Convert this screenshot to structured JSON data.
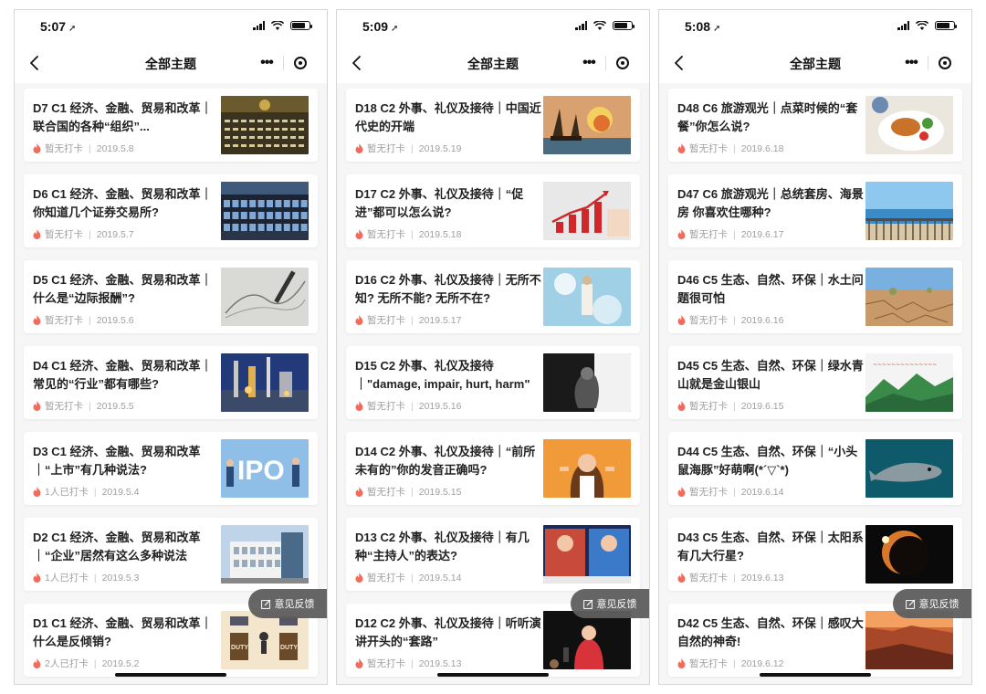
{
  "phones": [
    {
      "time": "5:07",
      "title": "全部主题",
      "feedback": "意见反馈",
      "items": [
        {
          "title": "D7 C1 经济、金融、贸易和改革｜联合国的各种“组织”...",
          "checkin": "暂无打卡",
          "date": "2019.5.8"
        },
        {
          "title": "D6 C1 经济、金融、贸易和改革｜你知道几个证券交易所?",
          "checkin": "暂无打卡",
          "date": "2019.5.7"
        },
        {
          "title": "D5 C1 经济、金融、贸易和改革｜什么是“边际报酬”?",
          "checkin": "暂无打卡",
          "date": "2019.5.6"
        },
        {
          "title": "D4 C1 经济、金融、贸易和改革｜常见的“行业”都有哪些?",
          "checkin": "暂无打卡",
          "date": "2019.5.5"
        },
        {
          "title": "D3 C1 经济、金融、贸易和改革｜“上市”有几种说法?",
          "checkin": "1人已打卡",
          "date": "2019.5.4"
        },
        {
          "title": "D2 C1 经济、金融、贸易和改革｜“企业”居然有这么多种说法",
          "checkin": "1人已打卡",
          "date": "2019.5.3"
        },
        {
          "title": "D1 C1 经济、金融、贸易和改革｜什么是反倾销?",
          "checkin": "2人已打卡",
          "date": "2019.5.2"
        }
      ]
    },
    {
      "time": "5:09",
      "title": "全部主题",
      "feedback": "意见反馈",
      "items": [
        {
          "title": "D18 C2 外事、礼仪及接待｜中国近代史的开端",
          "checkin": "暂无打卡",
          "date": "2019.5.19"
        },
        {
          "title": "D17 C2 外事、礼仪及接待｜“促进”都可以怎么说?",
          "checkin": "暂无打卡",
          "date": "2019.5.18"
        },
        {
          "title": "D16 C2 外事、礼仪及接待｜无所不知? 无所不能? 无所不在?",
          "checkin": "暂无打卡",
          "date": "2019.5.17"
        },
        {
          "title": "D15 C2 外事、礼仪及接待｜\"damage, impair, hurt, harm\" ...",
          "checkin": "暂无打卡",
          "date": "2019.5.16"
        },
        {
          "title": "D14 C2 外事、礼仪及接待｜“前所未有的”你的发音正确吗?",
          "checkin": "暂无打卡",
          "date": "2019.5.15"
        },
        {
          "title": "D13 C2 外事、礼仪及接待｜有几种“主持人”的表达?",
          "checkin": "暂无打卡",
          "date": "2019.5.14"
        },
        {
          "title": "D12 C2 外事、礼仪及接待｜听听演讲开头的“套路”",
          "checkin": "暂无打卡",
          "date": "2019.5.13"
        }
      ]
    },
    {
      "time": "5:08",
      "title": "全部主题",
      "feedback": "意见反馈",
      "items": [
        {
          "title": "D48 C6 旅游观光｜点菜时候的“套餐”你怎么说?",
          "checkin": "暂无打卡",
          "date": "2019.6.18"
        },
        {
          "title": "D47 C6 旅游观光｜总统套房、海景房 你喜欢住哪种?",
          "checkin": "暂无打卡",
          "date": "2019.6.17"
        },
        {
          "title": "D46 C5 生态、自然、环保｜水土问题很可怕",
          "checkin": "暂无打卡",
          "date": "2019.6.16"
        },
        {
          "title": "D45 C5 生态、自然、环保｜绿水青山就是金山银山",
          "checkin": "暂无打卡",
          "date": "2019.6.15"
        },
        {
          "title": "D44 C5 生态、自然、环保｜“小头鼠海豚”好萌啊(*´▽`*)",
          "checkin": "暂无打卡",
          "date": "2019.6.14"
        },
        {
          "title": "D43 C5 生态、自然、环保｜太阳系有几大行星?",
          "checkin": "暂无打卡",
          "date": "2019.6.13"
        },
        {
          "title": "D42 C5 生态、自然、环保｜感叹大自然的神奇!",
          "checkin": "暂无打卡",
          "date": "2019.6.12"
        }
      ]
    }
  ],
  "thumbnails": [
    [
      "un-assembly-hall-image",
      "stock-exchange-floor-image",
      "pen-on-chart-image",
      "industrial-plant-image",
      "ipo-illustration-image",
      "office-building-image",
      "anti-dumping-cartoon-image"
    ],
    [
      "burning-ships-painting-image",
      "growth-bar-chart-image",
      "jesus-clouds-image",
      "sad-person-bw-image",
      "surprised-woman-image",
      "news-anchors-image",
      "woman-speaker-image"
    ],
    [
      "roast-dinner-plate-image",
      "seaview-balcony-image",
      "dry-cracked-land-image",
      "green-mountains-image",
      "porpoise-image",
      "solar-eclipse-image",
      "canyon-landscape-image"
    ]
  ],
  "icons": {
    "back": "chevron-left-icon",
    "more": "more-dots-icon",
    "close": "target-icon",
    "fire": "fire-icon",
    "feedback": "edit-icon"
  },
  "colors": {
    "background": "#f6f6f6",
    "card": "#ffffff",
    "meta_text": "#a0a0a0",
    "fire": "#f26b5b",
    "feedback_bg": "#5e5e5e"
  }
}
